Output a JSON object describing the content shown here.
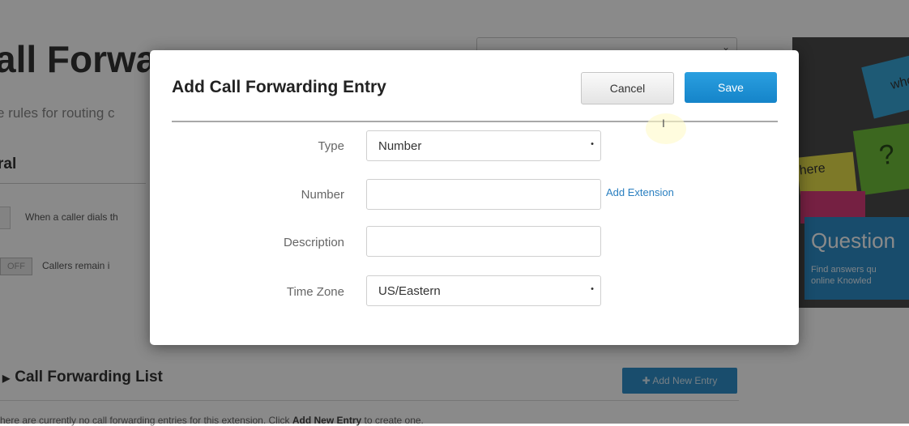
{
  "background": {
    "page_title": "all Forwa",
    "page_subtitle": "e rules for routing c",
    "general_heading": "ral",
    "caller_dials_text": "When a caller dials th",
    "toggle_off_label": "OFF",
    "callers_remain_text": "Callers remain i",
    "list_heading": "Call Forwarding List",
    "add_new_entry_label": "Add New Entry",
    "list_note_prefix": "here are currently no call forwarding entries for this extension. Click ",
    "list_note_bold": "Add New Entry",
    "list_note_suffix": " to create one.",
    "help_panel": {
      "note_text_left": "here",
      "note_text_right": "who",
      "note_symbol": "?",
      "title": "Question",
      "desc_line1": "Find answers qu",
      "desc_line2": "online Knowled"
    }
  },
  "modal": {
    "title": "Add Call Forwarding Entry",
    "cancel_label": "Cancel",
    "save_label": "Save",
    "fields": {
      "type": {
        "label": "Type",
        "value": "Number"
      },
      "number": {
        "label": "Number",
        "value": "",
        "add_extension_label": "Add Extension"
      },
      "description": {
        "label": "Description",
        "value": ""
      },
      "time_zone": {
        "label": "Time Zone",
        "value": "US/Eastern"
      }
    }
  },
  "colors": {
    "save_button": "#1a8fd6",
    "link": "#2a7fc0",
    "add_entry_button": "#2f8fc9",
    "help_box": "#2d8cc8"
  }
}
